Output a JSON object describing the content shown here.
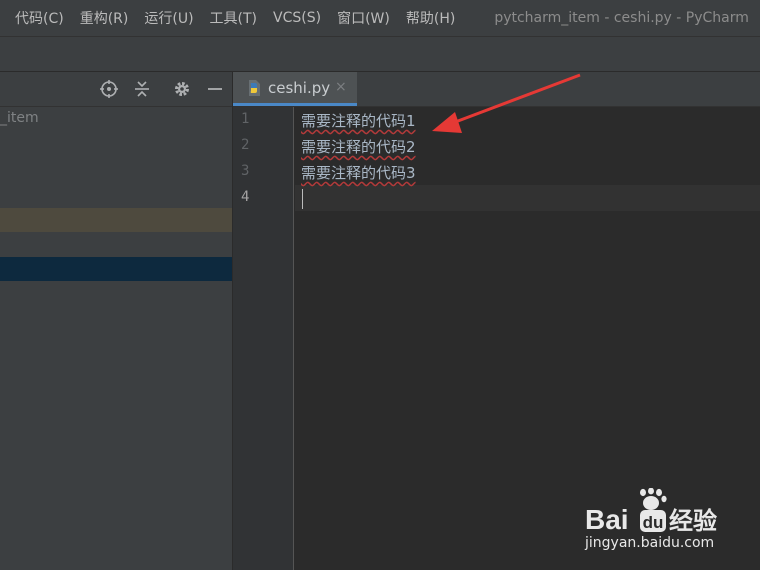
{
  "menu": {
    "items": [
      "代码(C)",
      "重构(R)",
      "运行(U)",
      "工具(T)",
      "VCS(S)",
      "窗口(W)",
      "帮助(H)"
    ],
    "window_title": "pytcharm_item - ceshi.py - PyCharm"
  },
  "project_panel": {
    "root_label": "item",
    "tools": [
      "locate-icon",
      "collapse-all-icon",
      "gear-icon",
      "minimize-icon"
    ]
  },
  "editor_tab": {
    "label": "ceshi.py",
    "close": "×",
    "file_type_icon": "python-file-icon"
  },
  "gutter": {
    "line_numbers": [
      "1",
      "2",
      "3",
      "4"
    ]
  },
  "code": {
    "lines": [
      "需要注释的代码1",
      "需要注释的代码2",
      "需要注释的代码3",
      ""
    ],
    "caret_line": 4
  },
  "watermark": {
    "logo_text": "Bai du 经验",
    "url": "jingyan.baidu.com"
  },
  "colors": {
    "editor_bg": "#2b2b2b",
    "panel_bg": "#3c3f41",
    "tab_accent": "#4a88c7",
    "arrow": "#e53935",
    "spell_underline": "#b33a3a"
  }
}
